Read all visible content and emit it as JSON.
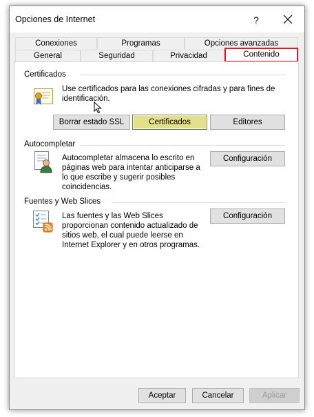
{
  "window": {
    "title": "Opciones de Internet"
  },
  "titlebar": {
    "help_label": "?"
  },
  "tabs": {
    "row1": [
      "Conexiones",
      "Programas",
      "Opciones avanzadas"
    ],
    "row2": [
      "General",
      "Seguridad",
      "Privacidad",
      "Contenido"
    ],
    "active": "Contenido"
  },
  "certificates": {
    "title": "Certificados",
    "description_line1": "Use certificados para las conexiones cifradas y para fines de",
    "description_line2": "identificación.",
    "buttons": [
      "Borrar estado SSL",
      "Certificados",
      "Editores"
    ]
  },
  "autocomplete": {
    "title": "Autocompletar",
    "description": [
      "Autocompletar almacena lo escrito en",
      "páginas web para intentar anticiparse a",
      "lo que escribe y sugerir posibles",
      "coincidencias."
    ],
    "button": "Configuración"
  },
  "feeds": {
    "title": "Fuentes y Web Slices",
    "description": [
      "Las fuentes y las Web Slices",
      "proporcionan contenido actualizado de",
      "sitios web, el cual puede leerse en",
      "Internet Explorer y en otros programas."
    ],
    "button": "Configuración"
  },
  "footer": {
    "ok": "Aceptar",
    "cancel": "Cancelar",
    "apply": "Aplicar"
  },
  "colors": {
    "active_tab_border": "#e01b24",
    "focused_button": "#e2e08a"
  }
}
